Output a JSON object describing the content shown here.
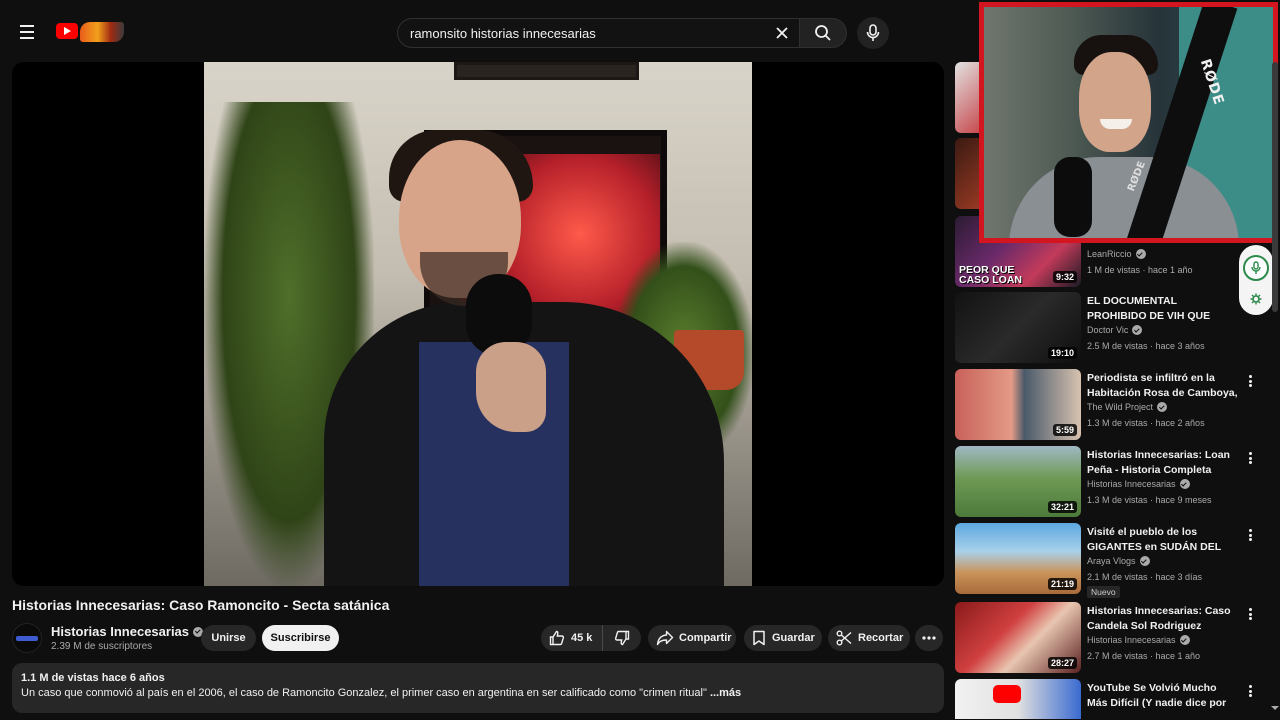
{
  "search": {
    "query": "ramonsito historias innecesarias"
  },
  "video": {
    "title": "Historias Innecesarias: Caso Ramoncito - Secta satánica",
    "channel": "Historias Innecesarias",
    "subscribers": "2.39 M de suscriptores",
    "join_label": "Unirse",
    "subscribe_label": "Suscribirse",
    "likes": "45 k",
    "share_label": "Compartir",
    "save_label": "Guardar",
    "clip_label": "Recortar",
    "views_and_date": "1.1 M de vistas  hace 6 años",
    "description": "Un caso que conmovió al país en el 2006, el caso de Ramoncito Gonzalez, el primer caso en argentina en ser calificado como \"crimen ritual\"",
    "more_label": " ...más"
  },
  "recommendations": [
    {
      "overlay_caption": "PEOR QUE\nCASO LOAN",
      "duration": "9:32",
      "title": "",
      "channel": "LeanRiccio",
      "meta": "1 M de vistas · hace 1 año"
    },
    {
      "duration": "19:10",
      "title": "EL DOCUMENTAL PROHIBIDO DE VIH QUE ATERRORIZÓ A L...",
      "channel": "Doctor Vic",
      "meta": "2.5 M de vistas · hace 3 años"
    },
    {
      "duration": "5:59",
      "title": "Periodista se infiltró en la Habitación Rosa de Camboya, ...",
      "channel": "The Wild Project",
      "meta": "1.3 M de vistas · hace 2 años"
    },
    {
      "duration": "32:21",
      "title": "Historias Innecesarias: Loan Peña - Historia Completa",
      "channel": "Historias Innecesarias",
      "meta": "1.3 M de vistas · hace 9 meses"
    },
    {
      "duration": "21:19",
      "title": "Visité el pueblo de los GIGANTES en SUDÁN DEL SU...",
      "channel": "Araya Vlogs",
      "meta": "2.1 M de vistas · hace 3 días",
      "badge": "Nuevo"
    },
    {
      "duration": "28:27",
      "title": "Historias Innecesarias: Caso Candela Sol Rodriguez",
      "channel": "Historias Innecesarias",
      "meta": "2.7 M de vistas · hace 1 año"
    },
    {
      "duration": "",
      "title": "YouTube Se Volvió Mucho Más Difícil (Y nadie dice por qué)",
      "channel": "",
      "meta": ""
    }
  ],
  "webcam": {
    "brand_text": "RØDE",
    "brand_text_2": "RØDE"
  },
  "colors": {
    "accent_red": "#d2151e",
    "youtube_red": "#ff0000",
    "background": "#0f0f0f"
  }
}
